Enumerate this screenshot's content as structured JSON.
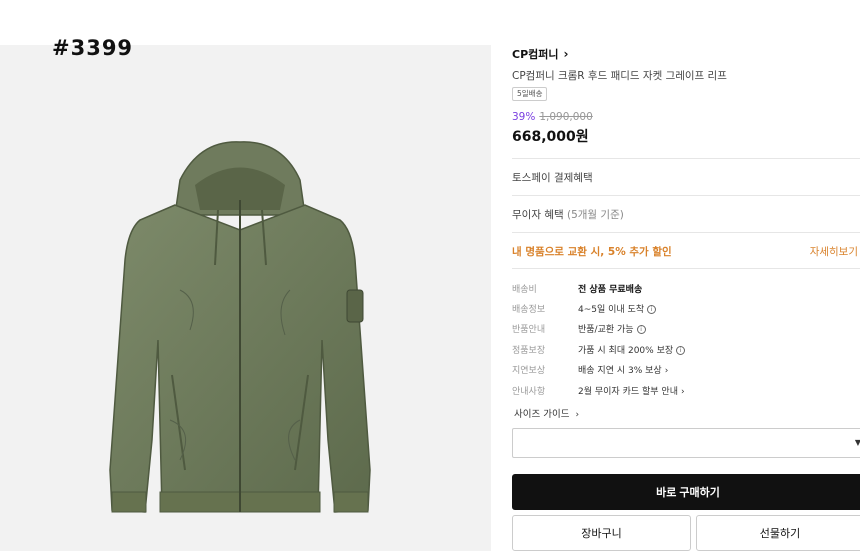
{
  "listing_id": "#3399",
  "product": {
    "brand": "CP컴퍼니",
    "title": "CP컴퍼니 크롬R 후드 패디드 자켓 그레이프 리프",
    "tag": "5일배송",
    "discount": "39%",
    "original_price": "1,090,000",
    "price": "668,000원",
    "image_icon": "jacket-illustration",
    "image_color": "#6e7a5c"
  },
  "benefits": {
    "toss": "토스페이 결제혜택",
    "interest_free_label": "무이자 혜택",
    "interest_free_note": "(5개월 기준)",
    "trade_in": "내 명품으로 교환 시, 5% 추가 할인",
    "trade_in_link": "자세히보기",
    "accent_color": "#d9822b"
  },
  "specs": [
    {
      "key": "배송비",
      "value": "전 상품 무료배송",
      "suffix": ""
    },
    {
      "key": "배송정보",
      "value": "4~5일 이내 도착",
      "suffix": "info"
    },
    {
      "key": "반품안내",
      "value": "반품/교환 가능",
      "suffix": "info"
    },
    {
      "key": "정품보장",
      "value": "가품 시 최대 200% 보장",
      "suffix": "info"
    },
    {
      "key": "지연보상",
      "value": "배송 지연 시 3% 보상",
      "suffix": "chevron"
    },
    {
      "key": "안내사항",
      "value": "2월 무이자 카드 할부 안내",
      "suffix": "chevron"
    }
  ],
  "size_guide": "사이즈 가이드",
  "size_select_value": "",
  "buttons": {
    "buy": "바로 구매하기",
    "cart": "장바구니",
    "gift": "선물하기"
  }
}
